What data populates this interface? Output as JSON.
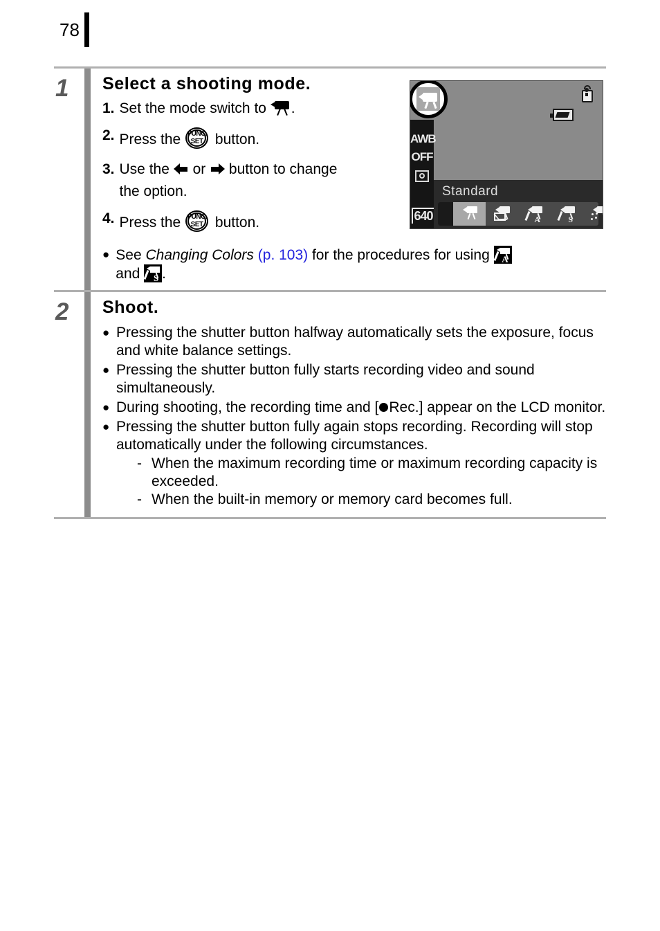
{
  "page": {
    "number": "78"
  },
  "steps": [
    {
      "number": "1",
      "title": "Select a shooting mode.",
      "substeps": [
        {
          "num": "1.",
          "pre": "Set the mode switch to ",
          "icon": "movie-camera-icon",
          "post": "."
        },
        {
          "num": "2.",
          "pre": "Press the ",
          "icon": "func-set-button-icon",
          "post": " button."
        },
        {
          "num": "3.",
          "pre": "Use the ",
          "icon": "left-arrow-icon",
          "mid": " or ",
          "icon2": "right-arrow-icon",
          "post": " button to change",
          "line2": "the option."
        },
        {
          "num": "4.",
          "pre": "Press the ",
          "icon": "func-set-button-icon",
          "post": " button."
        }
      ],
      "note": {
        "lead": "See ",
        "italic_title": "Changing Colors",
        "page_ref": "(p. 103)",
        "middle": " for the procedures for using ",
        "icon_a": "color-accent-icon",
        "and": "and",
        "icon_s": "color-swap-icon",
        "period": "."
      }
    },
    {
      "number": "2",
      "title": "Shoot.",
      "bullets": [
        "Pressing the shutter button halfway automatically sets the exposure, focus and white balance settings.",
        "Pressing the shutter button fully starts recording video and sound simultaneously.",
        "During shooting, the recording time and [●Rec.] appear on the LCD monitor.",
        "Pressing the shutter button fully again stops recording. Recording will stop automatically under the following circumstances."
      ],
      "bullet3_parts": {
        "pre": "During shooting, the recording time and [",
        "post": "Rec.] appear on the LCD monitor."
      },
      "subbullets": [
        "When the maximum recording time or maximum recording capacity is exceeded.",
        "When the built-in memory or memory card becomes full."
      ],
      "dash": "-"
    }
  ],
  "lcd": {
    "mode_icon": "movie-mode-icon",
    "left_column": {
      "white_balance": "AWB",
      "flash": "OFF",
      "metering": "metering-mode-icon",
      "resolution": "640"
    },
    "top_right": {
      "sound": "microphone-icon",
      "battery": "battery-icon"
    },
    "mode_name": "Standard",
    "mode_options": [
      {
        "name": "standard-movie-icon",
        "selected": true,
        "letter": ""
      },
      {
        "name": "compact-movie-icon",
        "selected": false,
        "letter": ""
      },
      {
        "name": "color-accent-movie-icon",
        "selected": false,
        "letter": "A"
      },
      {
        "name": "color-swap-movie-icon",
        "selected": false,
        "letter": "S"
      },
      {
        "name": "my-colors-movie-icon",
        "selected": false,
        "letter": ""
      }
    ]
  },
  "colors": {
    "rule": "#b0b0b0",
    "step_divider": "#8c8c8c",
    "step_number": "#5a5a5a",
    "page_ref_blue": "#2222dd",
    "lcd_background": "#8a8a8a",
    "lcd_panel_dark": "#2a2a2a"
  }
}
